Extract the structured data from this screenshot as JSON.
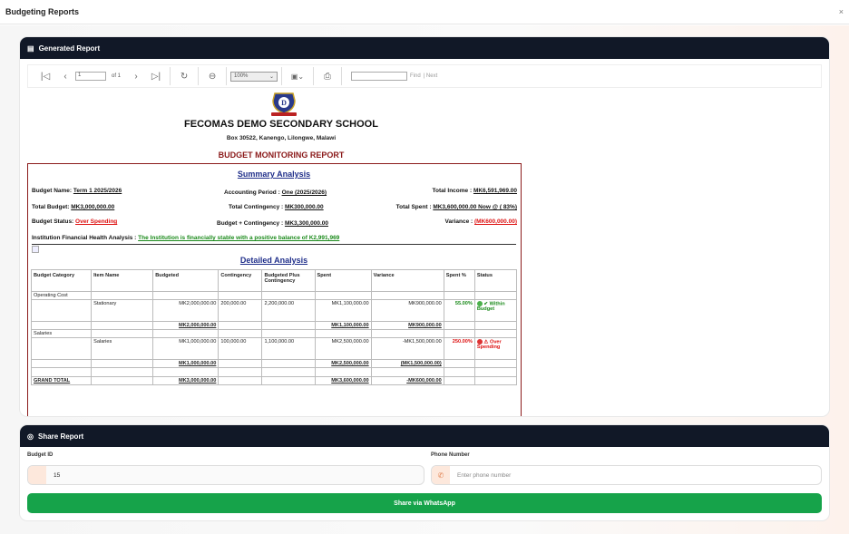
{
  "modal": {
    "title": "Budgeting Reports",
    "close": "×"
  },
  "report_card": {
    "title": "Generated Report",
    "icon": "document-icon"
  },
  "toolbar": {
    "first": "⏮",
    "prev": "‹",
    "page": "1",
    "of_pages": "of 1",
    "next": "›",
    "last": "⏭",
    "refresh": "↻",
    "back": "⊖",
    "zoom": "100%",
    "save": "💾",
    "print": "🖶",
    "find": "Find",
    "next_link": "| Next"
  },
  "doc": {
    "school": "FECOMAS DEMO SECONDARY SCHOOL",
    "address": "Box 30522, Kanengo, Lilongwe, Malawi",
    "report_title": "BUDGET MONITORING REPORT",
    "summary_title": "Summary Analysis",
    "budget_name_label": "Budget Name:",
    "budget_name": "Term 1 2025/2026",
    "period_label": "Accounting Period :",
    "period": "One (2025/2026)",
    "income_label": "Total Income :",
    "income": "MK6,591,969.00",
    "total_budget_label": "Total Budget:",
    "total_budget": "MK3,000,000.00",
    "contingency_label": "Total Contingency :",
    "contingency": "MK300,000.00",
    "spent_label": "Total Spent :",
    "spent": "MK3,600,000.00 Now @ ( 83%)",
    "status_label": "Budget Status:",
    "status": "Over Spending",
    "bpc_label": "Budget + Contingency :",
    "bpc": "MK3,300,000.00",
    "variance_label": "Variance :",
    "variance": "(MK600,000.00)",
    "health_label": "Institution Financial Health Analysis :",
    "health": "The Institution is financially stable with a positive balance of K2,991,969",
    "detailed_title": "Detailed Analysis",
    "headers": [
      "Budget Category",
      "Item Name",
      "Budgeted",
      "Contingency",
      "Budgeted Plus Contingency",
      "Spent",
      "Variance",
      "Spent %",
      "Status"
    ],
    "op_category": "Operating Cost",
    "stationary": [
      "Stationary",
      "MK2,000,000.00",
      "200,000.00",
      "2,200,000.00",
      "MK1,100,000.00",
      "MK900,000.00",
      "55.00%",
      "✔ Within Budget"
    ],
    "op_sub": [
      "MK2,000,000.00",
      "MK1,100,000.00",
      "MK900,000.00"
    ],
    "sal_category": "Salaries",
    "salaries": [
      "Salaries",
      "MK1,000,000.00",
      "100,000.00",
      "1,100,000.00",
      "MK2,500,000.00",
      "-MK1,500,000.00",
      "250.00%",
      "⚠ Over Spending"
    ],
    "sal_sub": [
      "MK1,000,000.00",
      "MK2,500,000.00",
      "(MK1,500,000.00)"
    ],
    "grand_label": "GRAND TOTAL",
    "grand": [
      "MK3,000,000.00",
      "MK3,600,000.00",
      "-MK600,000.00"
    ]
  },
  "share_card": {
    "title": "Share Report",
    "icon": "whatsapp-icon",
    "budget_id_label": "Budget ID",
    "budget_id": "15",
    "phone_label": "Phone Number",
    "phone_placeholder": "Enter phone number",
    "button": "Share via WhatsApp"
  },
  "colors": {
    "header": "#111827",
    "accent_green": "#16a34a",
    "report_red": "#8b1a1a"
  }
}
